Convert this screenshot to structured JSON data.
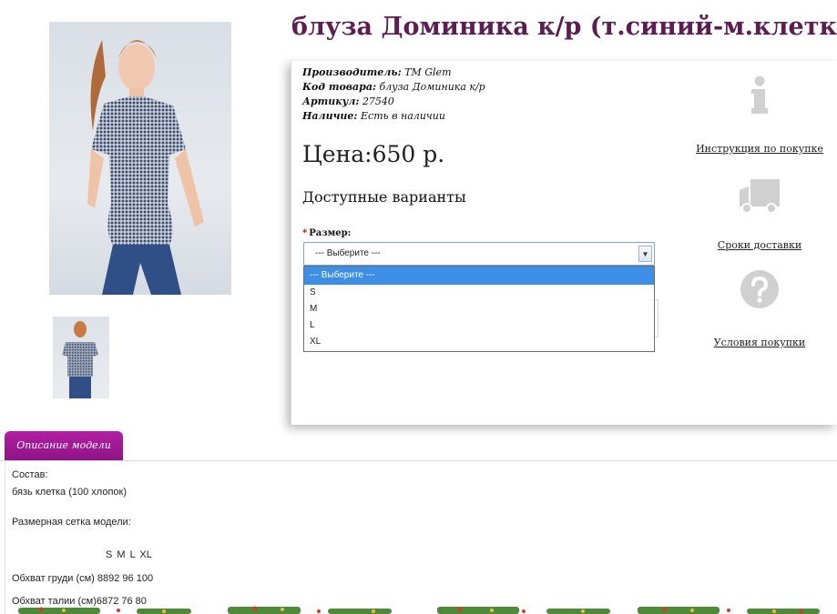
{
  "product": {
    "title": "блуза Доминика к/р (т.синий-м.клетка)"
  },
  "meta": {
    "manufacturer_label": "Производитель:",
    "manufacturer_value": "TM Glem",
    "code_label": "Код товара:",
    "code_value": "блуза Доминика к/р",
    "article_label": "Артикул:",
    "article_value": "27540",
    "availability_label": "Наличие:",
    "availability_value": "Есть в наличии"
  },
  "price": "Цена:650 р.",
  "variants_title": "Доступные варианты",
  "size": {
    "required_mark": "*",
    "label": "Размер:",
    "selected": "--- Выберите ---",
    "options": [
      "--- Выберите ---",
      "S",
      "M",
      "L",
      "XL"
    ]
  },
  "sidebar": {
    "instructions_link": "Инструкция по покупке",
    "delivery_link": "Сроки доставки",
    "terms_link": "Условия покупки"
  },
  "tabs": {
    "description": "Описание модели"
  },
  "description": {
    "composition_label": "Состав:",
    "composition_value": "бязь клетка (100 хлопок)",
    "size_grid_label": "Размерная сетка модели:",
    "size_header": "S  M  L  XL",
    "chest_row": "Обхват груди (см) 8892 96 100",
    "waist_row": "Обхват талии (см)6872 76  80"
  },
  "colors": {
    "title": "#5b1d52",
    "tab": "#9b1893",
    "dropdown_selected": "#3d8ee6",
    "icon_gray": "#d0d0d0"
  }
}
